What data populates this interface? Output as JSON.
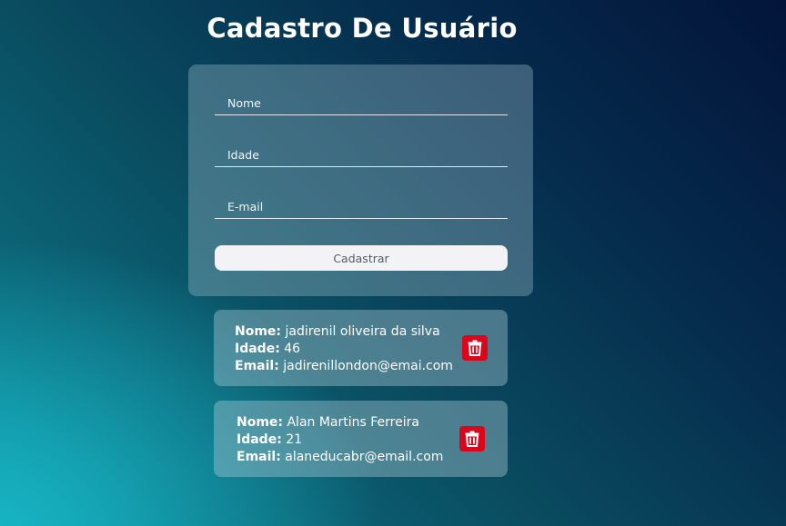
{
  "page": {
    "title": "Cadastro De Usuário"
  },
  "form": {
    "name_placeholder": "Nome",
    "age_placeholder": "Idade",
    "email_placeholder": "E-mail",
    "submit_label": "Cadastrar"
  },
  "users": [
    {
      "name_label": "Nome:",
      "name": "jadirenil oliveira da silva",
      "age_label": "Idade:",
      "age": "46",
      "email_label": "Email:",
      "email": "jadirenillondon@emai.com",
      "delete_icon": "trash-icon"
    },
    {
      "name_label": "Nome:",
      "name": "Alan Martins Ferreira",
      "age_label": "Idade:",
      "age": "21",
      "email_label": "Email:",
      "email": "alaneducabr@email.com",
      "delete_icon": "trash-icon"
    }
  ],
  "colors": {
    "background_dark": "#03143a",
    "background_teal": "#17b3c3",
    "delete_red": "#d9061c",
    "button_light": "#f3f3f5"
  }
}
